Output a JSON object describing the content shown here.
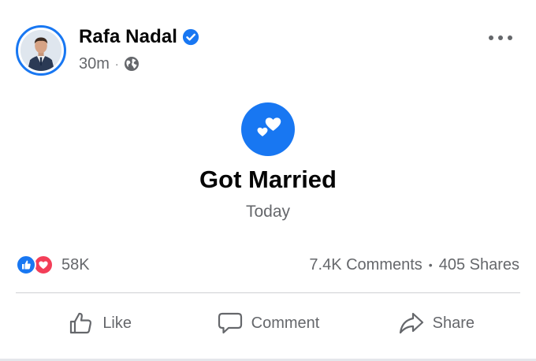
{
  "post": {
    "author_name": "Rafa Nadal",
    "verified_icon": "verified-badge-icon",
    "timestamp": "30m",
    "meta_separator": "·",
    "audience_icon": "globe-icon",
    "more_icon": "more-options-icon"
  },
  "life_event": {
    "icon": "hearts-icon",
    "title": "Got Married",
    "date": "Today"
  },
  "engagement": {
    "reaction_icons": [
      "like-reaction-icon",
      "love-reaction-icon"
    ],
    "reaction_count": "58K",
    "comments": "7.4K Comments",
    "separator": "•",
    "shares": "405 Shares"
  },
  "actions": {
    "like_label": "Like",
    "comment_label": "Comment",
    "share_label": "Share"
  },
  "colors": {
    "brand_blue": "#1877f2",
    "love_red": "#f33e58",
    "secondary_text": "#65676b",
    "divider": "#ced0d4"
  }
}
